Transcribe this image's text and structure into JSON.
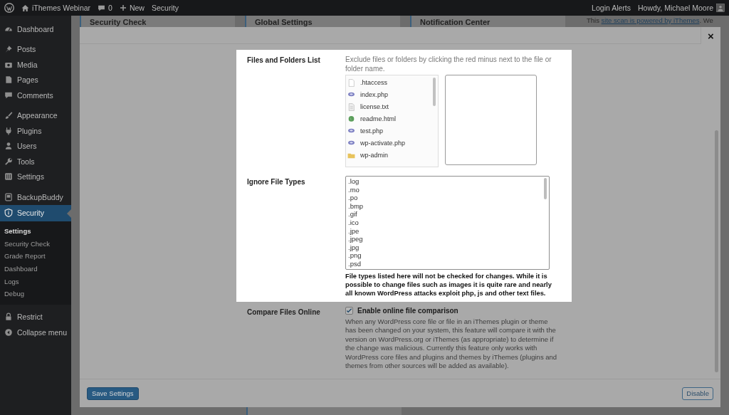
{
  "admin_bar": {
    "site_name": "iThemes Webinar",
    "comment_count": "0",
    "new_label": "New",
    "menu_label": "Security",
    "login_alerts": "Login Alerts",
    "greeting": "Howdy, Michael Moore"
  },
  "sidebar": {
    "groups": [
      {
        "items": [
          {
            "label": "Dashboard",
            "selected": false
          }
        ]
      },
      {
        "items": [
          {
            "label": "Posts",
            "selected": false
          },
          {
            "label": "Media",
            "selected": false
          },
          {
            "label": "Pages",
            "selected": false
          },
          {
            "label": "Comments",
            "selected": false
          }
        ]
      },
      {
        "items": [
          {
            "label": "Appearance",
            "selected": false
          },
          {
            "label": "Plugins",
            "selected": false
          },
          {
            "label": "Users",
            "selected": false
          },
          {
            "label": "Tools",
            "selected": false
          },
          {
            "label": "Settings",
            "selected": false
          }
        ]
      },
      {
        "items": [
          {
            "label": "BackupBuddy",
            "selected": false
          },
          {
            "label": "Security",
            "selected": true,
            "children": [
              {
                "label": "Settings",
                "selected": true
              },
              {
                "label": "Security Check",
                "selected": false
              },
              {
                "label": "Grade Report",
                "selected": false
              },
              {
                "label": "Dashboard",
                "selected": false
              },
              {
                "label": "Logs",
                "selected": false
              },
              {
                "label": "Debug",
                "selected": false
              }
            ]
          }
        ]
      },
      {
        "items": [
          {
            "label": "Restrict",
            "selected": false
          },
          {
            "label": "Collapse menu",
            "selected": false
          }
        ]
      }
    ]
  },
  "background": {
    "cards": [
      {
        "title": "Security Check"
      },
      {
        "title": "Global Settings"
      },
      {
        "title": "Notification Center"
      }
    ],
    "note": {
      "before": "This ",
      "link": "site scan is powered by iThemes",
      "after": ". We"
    }
  },
  "modal": {
    "close": "×",
    "files": {
      "label": "Files and Folders List",
      "description": "Exclude files or folders by clicking the red minus next to the file or folder name.",
      "items": [
        {
          "name": ".htaccess",
          "kind": "blank"
        },
        {
          "name": "index.php",
          "kind": "php"
        },
        {
          "name": "license.txt",
          "kind": "text"
        },
        {
          "name": "readme.html",
          "kind": "web"
        },
        {
          "name": "test.php",
          "kind": "php"
        },
        {
          "name": "wp-activate.php",
          "kind": "php"
        },
        {
          "name": "wp-admin",
          "kind": "folder"
        }
      ]
    },
    "ignore": {
      "label": "Ignore File Types",
      "value": ".log\n.mo\n.po\n.bmp\n.gif\n.ico\n.jpe\n.jpeg\n.jpg\n.png\n.psd",
      "description": "File types listed here will not be checked for changes. While it is possible to change files such as images it is quite rare and nearly all known WordPress attacks exploit php, js and other text files."
    },
    "compare": {
      "label": "Compare Files Online",
      "checkbox": {
        "label": "Enable online file comparison",
        "checked": true
      },
      "description": "When any WordPress core file or file in an iThemes plugin or theme has been changed on your system, this feature will compare it with the version on WordPress.org or iThemes (as appropriate) to determine if the change was malicious. Currently this feature only works with WordPress core files and plugins and themes by iThemes (plugins and themes from other sources will be added as available)."
    },
    "footer": {
      "save": "Save Settings",
      "disable": "Disable"
    }
  }
}
